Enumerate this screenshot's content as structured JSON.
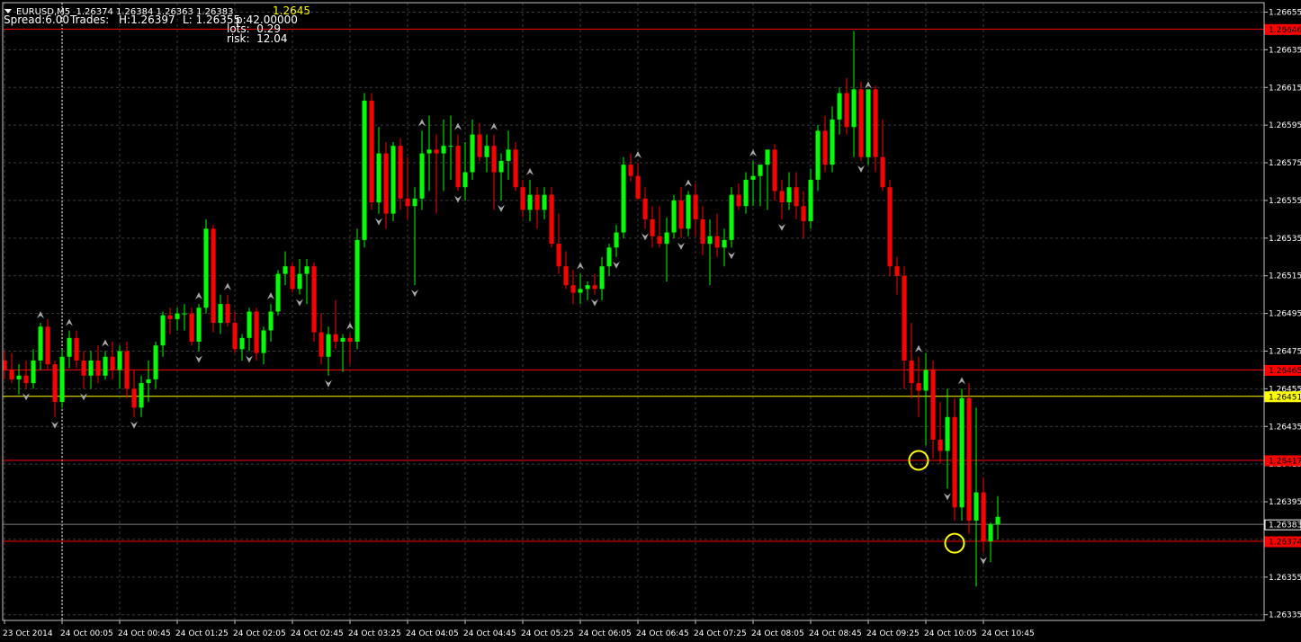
{
  "header": {
    "symbol_line": "EURUSD,M5  1.26374 1.26384 1.26363 1.26383",
    "spread": "Spread:6.00",
    "trades": "Trades:",
    "high": "H:1.26397",
    "low": "L: 1.26355",
    "pips": "p:42.00000",
    "lots": "lots:  0.29",
    "risk": "risk:  12.04",
    "level": "1.2645"
  },
  "colors": {
    "background": "#000000",
    "grid": "#3a3a3a",
    "bull": "#00ff00",
    "bear": "#ff0000",
    "frame": "#c0c0c0",
    "fractal": "#a8a8a8",
    "crosshair": "#ffffff",
    "circle": "#ffff00"
  },
  "chart_data": {
    "type": "candlestick",
    "symbol": "EURUSD",
    "timeframe": "M5",
    "ylim": [
      1.26332,
      1.2666
    ],
    "y_ticks": [
      1.26655,
      1.26635,
      1.26615,
      1.26595,
      1.26575,
      1.26555,
      1.26535,
      1.26515,
      1.26495,
      1.26475,
      1.26455,
      1.26435,
      1.26415,
      1.26395,
      1.26375,
      1.26355,
      1.26335
    ],
    "x_ticks": [
      {
        "i": 0,
        "label": "23 Oct 2014"
      },
      {
        "i": 8,
        "label": "24 Oct 00:05"
      },
      {
        "i": 16,
        "label": "24 Oct 00:45"
      },
      {
        "i": 24,
        "label": "24 Oct 01:25"
      },
      {
        "i": 32,
        "label": "24 Oct 02:05"
      },
      {
        "i": 40,
        "label": "24 Oct 02:45"
      },
      {
        "i": 48,
        "label": "24 Oct 03:25"
      },
      {
        "i": 56,
        "label": "24 Oct 04:05"
      },
      {
        "i": 64,
        "label": "24 Oct 04:45"
      },
      {
        "i": 72,
        "label": "24 Oct 05:25"
      },
      {
        "i": 80,
        "label": "24 Oct 06:05"
      },
      {
        "i": 88,
        "label": "24 Oct 06:45"
      },
      {
        "i": 96,
        "label": "24 Oct 07:25"
      },
      {
        "i": 104,
        "label": "24 Oct 08:05"
      },
      {
        "i": 112,
        "label": "24 Oct 08:45"
      },
      {
        "i": 120,
        "label": "24 Oct 09:25"
      },
      {
        "i": 128,
        "label": "24 Oct 10:05"
      },
      {
        "i": 136,
        "label": "24 Oct 10:45"
      }
    ],
    "horizontal_lines": [
      {
        "price": 1.26646,
        "label": "1.26646",
        "color": "#ff0000",
        "width": 1
      },
      {
        "price": 1.26465,
        "label": "1.26465",
        "color": "#ff0000",
        "width": 1
      },
      {
        "price": 1.26451,
        "label": "1.26451",
        "color": "#ffff00",
        "width": 1
      },
      {
        "price": 1.26417,
        "label": "1.26417",
        "color": "#ff0000",
        "width": 1
      },
      {
        "price": 1.26374,
        "label": "1.26374",
        "color": "#ff0000",
        "width": 1
      },
      {
        "price": 1.26383,
        "label": "1.26383",
        "color": "#808080",
        "width": 1
      }
    ],
    "crosshair_index": 8,
    "circles": [
      {
        "i": 127,
        "price": 1.26417
      },
      {
        "i": 132,
        "price": 1.26373
      }
    ],
    "candles": [
      [
        1.2647,
        1.26475,
        1.2646,
        1.26465
      ],
      [
        1.26465,
        1.26474,
        1.26458,
        1.2646
      ],
      [
        1.2646,
        1.26468,
        1.26452,
        1.26462
      ],
      [
        1.26462,
        1.2647,
        1.26455,
        1.26458
      ],
      [
        1.26458,
        1.26476,
        1.26455,
        1.2647
      ],
      [
        1.2647,
        1.2649,
        1.26465,
        1.26488
      ],
      [
        1.26488,
        1.26492,
        1.26465,
        1.26468
      ],
      [
        1.26468,
        1.2647,
        1.2644,
        1.26448
      ],
      [
        1.26448,
        1.26476,
        1.26445,
        1.26472
      ],
      [
        1.26472,
        1.26486,
        1.26466,
        1.26482
      ],
      [
        1.26482,
        1.26486,
        1.26466,
        1.2647
      ],
      [
        1.2647,
        1.26475,
        1.26455,
        1.26462
      ],
      [
        1.26462,
        1.26475,
        1.26455,
        1.2647
      ],
      [
        1.2647,
        1.26478,
        1.26458,
        1.26462
      ],
      [
        1.26462,
        1.26475,
        1.2646,
        1.26472
      ],
      [
        1.26472,
        1.2648,
        1.2646,
        1.26465
      ],
      [
        1.26465,
        1.26478,
        1.26455,
        1.26475
      ],
      [
        1.26475,
        1.2648,
        1.2645,
        1.26455
      ],
      [
        1.26455,
        1.26465,
        1.2644,
        1.26445
      ],
      [
        1.26445,
        1.26462,
        1.2644,
        1.26458
      ],
      [
        1.26458,
        1.2647,
        1.26448,
        1.2646
      ],
      [
        1.2646,
        1.2648,
        1.26455,
        1.26478
      ],
      [
        1.26478,
        1.26496,
        1.26472,
        1.26494
      ],
      [
        1.26494,
        1.26498,
        1.26484,
        1.26492
      ],
      [
        1.26492,
        1.26498,
        1.26486,
        1.26495
      ],
      [
        1.26495,
        1.265,
        1.26486,
        1.26495
      ],
      [
        1.26495,
        1.26498,
        1.26478,
        1.2648
      ],
      [
        1.2648,
        1.265,
        1.26475,
        1.26498
      ],
      [
        1.26498,
        1.26545,
        1.26495,
        1.2654
      ],
      [
        1.2654,
        1.26542,
        1.26485,
        1.2649
      ],
      [
        1.2649,
        1.26505,
        1.26484,
        1.265
      ],
      [
        1.265,
        1.26505,
        1.26488,
        1.2649
      ],
      [
        1.2649,
        1.26496,
        1.26474,
        1.26476
      ],
      [
        1.26476,
        1.26484,
        1.2647,
        1.26482
      ],
      [
        1.26482,
        1.26498,
        1.26475,
        1.26496
      ],
      [
        1.26496,
        1.26498,
        1.2647,
        1.26474
      ],
      [
        1.26474,
        1.26488,
        1.26468,
        1.26486
      ],
      [
        1.26486,
        1.265,
        1.2648,
        1.26496
      ],
      [
        1.26496,
        1.26518,
        1.26494,
        1.26516
      ],
      [
        1.26516,
        1.26528,
        1.2651,
        1.2652
      ],
      [
        1.2652,
        1.26522,
        1.26506,
        1.26508
      ],
      [
        1.26508,
        1.26524,
        1.26505,
        1.26516
      ],
      [
        1.26516,
        1.26524,
        1.265,
        1.2652
      ],
      [
        1.2652,
        1.26522,
        1.2648,
        1.26485
      ],
      [
        1.26485,
        1.26495,
        1.26468,
        1.26472
      ],
      [
        1.26472,
        1.26488,
        1.26462,
        1.26484
      ],
      [
        1.26484,
        1.26502,
        1.26476,
        1.2648
      ],
      [
        1.2648,
        1.26484,
        1.26464,
        1.26482
      ],
      [
        1.26482,
        1.26484,
        1.26468,
        1.2648
      ],
      [
        1.2648,
        1.2654,
        1.26476,
        1.26534
      ],
      [
        1.26534,
        1.26612,
        1.2653,
        1.26608
      ],
      [
        1.26608,
        1.26612,
        1.2655,
        1.26554
      ],
      [
        1.26554,
        1.26594,
        1.26548,
        1.2658
      ],
      [
        1.2658,
        1.26586,
        1.2654,
        1.26548
      ],
      [
        1.26548,
        1.26586,
        1.26544,
        1.26584
      ],
      [
        1.26584,
        1.26588,
        1.2655,
        1.26556
      ],
      [
        1.26556,
        1.26578,
        1.26545,
        1.26552
      ],
      [
        1.26552,
        1.26562,
        1.2651,
        1.26556
      ],
      [
        1.26556,
        1.26592,
        1.2655,
        1.2658
      ],
      [
        1.2658,
        1.266,
        1.2656,
        1.26582
      ],
      [
        1.26582,
        1.2659,
        1.26548,
        1.2658
      ],
      [
        1.2658,
        1.26598,
        1.2656,
        1.26584
      ],
      [
        1.26584,
        1.266,
        1.26566,
        1.26584
      ],
      [
        1.26584,
        1.2659,
        1.2656,
        1.26562
      ],
      [
        1.26562,
        1.26586,
        1.26555,
        1.2657
      ],
      [
        1.2657,
        1.26598,
        1.26566,
        1.2659
      ],
      [
        1.2659,
        1.26596,
        1.26576,
        1.26578
      ],
      [
        1.26578,
        1.2659,
        1.2657,
        1.26584
      ],
      [
        1.26584,
        1.2659,
        1.2655,
        1.2657
      ],
      [
        1.2657,
        1.2658,
        1.26555,
        1.26576
      ],
      [
        1.26576,
        1.26592,
        1.26566,
        1.26582
      ],
      [
        1.26582,
        1.26586,
        1.2656,
        1.26562
      ],
      [
        1.26562,
        1.26566,
        1.26546,
        1.2655
      ],
      [
        1.2655,
        1.26566,
        1.26544,
        1.26558
      ],
      [
        1.26558,
        1.26562,
        1.2654,
        1.2655
      ],
      [
        1.2655,
        1.26562,
        1.26545,
        1.26558
      ],
      [
        1.26558,
        1.26562,
        1.2653,
        1.26532
      ],
      [
        1.26532,
        1.26548,
        1.26516,
        1.2652
      ],
      [
        1.2652,
        1.26528,
        1.26508,
        1.2651
      ],
      [
        1.2651,
        1.26518,
        1.265,
        1.26506
      ],
      [
        1.26506,
        1.26516,
        1.265,
        1.26508
      ],
      [
        1.26508,
        1.26512,
        1.26502,
        1.2651
      ],
      [
        1.2651,
        1.26516,
        1.26505,
        1.26508
      ],
      [
        1.26508,
        1.26525,
        1.26502,
        1.2652
      ],
      [
        1.2652,
        1.26532,
        1.26515,
        1.2653
      ],
      [
        1.2653,
        1.26542,
        1.26525,
        1.26538
      ],
      [
        1.26538,
        1.26578,
        1.26535,
        1.26574
      ],
      [
        1.26574,
        1.2658,
        1.26565,
        1.26568
      ],
      [
        1.26568,
        1.26575,
        1.26555,
        1.26556
      ],
      [
        1.26556,
        1.26562,
        1.2654,
        1.26545
      ],
      [
        1.26545,
        1.26552,
        1.2653,
        1.26536
      ],
      [
        1.26536,
        1.26552,
        1.2653,
        1.26532
      ],
      [
        1.26532,
        1.26546,
        1.26512,
        1.26538
      ],
      [
        1.26538,
        1.26558,
        1.26535,
        1.26555
      ],
      [
        1.26555,
        1.26562,
        1.26535,
        1.2654
      ],
      [
        1.2654,
        1.2656,
        1.26536,
        1.26558
      ],
      [
        1.26558,
        1.26564,
        1.26536,
        1.26545
      ],
      [
        1.26545,
        1.26552,
        1.26526,
        1.26532
      ],
      [
        1.26532,
        1.26545,
        1.2651,
        1.26536
      ],
      [
        1.26536,
        1.26548,
        1.26525,
        1.2653
      ],
      [
        1.2653,
        1.2654,
        1.2652,
        1.26534
      ],
      [
        1.26534,
        1.26562,
        1.2653,
        1.26558
      ],
      [
        1.26558,
        1.26564,
        1.2655,
        1.26552
      ],
      [
        1.26552,
        1.2657,
        1.26548,
        1.26566
      ],
      [
        1.26566,
        1.26576,
        1.26552,
        1.26568
      ],
      [
        1.26568,
        1.26572,
        1.26552,
        1.26574
      ],
      [
        1.26574,
        1.2658,
        1.2655,
        1.26582
      ],
      [
        1.26582,
        1.26585,
        1.26555,
        1.2656
      ],
      [
        1.2656,
        1.26566,
        1.26545,
        1.26554
      ],
      [
        1.26554,
        1.2657,
        1.2655,
        1.26562
      ],
      [
        1.26562,
        1.2657,
        1.26545,
        1.26552
      ],
      [
        1.26552,
        1.2656,
        1.26535,
        1.26544
      ],
      [
        1.26544,
        1.26572,
        1.2654,
        1.26566
      ],
      [
        1.26566,
        1.26595,
        1.2656,
        1.26592
      ],
      [
        1.26592,
        1.266,
        1.2657,
        1.26574
      ],
      [
        1.26574,
        1.26605,
        1.2657,
        1.26598
      ],
      [
        1.26598,
        1.26615,
        1.2659,
        1.26612
      ],
      [
        1.26612,
        1.2662,
        1.2659,
        1.26594
      ],
      [
        1.26594,
        1.26645,
        1.26578,
        1.26614
      ],
      [
        1.26614,
        1.26618,
        1.26576,
        1.26578
      ],
      [
        1.26578,
        1.26612,
        1.26574,
        1.26614
      ],
      [
        1.26614,
        1.26616,
        1.2657,
        1.26578
      ],
      [
        1.26578,
        1.26598,
        1.2656,
        1.26562
      ],
      [
        1.26562,
        1.26566,
        1.26515,
        1.2652
      ],
      [
        1.2652,
        1.26525,
        1.26505,
        1.26515
      ],
      [
        1.26515,
        1.2652,
        1.26455,
        1.2647
      ],
      [
        1.2647,
        1.2649,
        1.2645,
        1.26458
      ],
      [
        1.26458,
        1.26472,
        1.2644,
        1.26454
      ],
      [
        1.26454,
        1.26474,
        1.26425,
        1.26465
      ],
      [
        1.26465,
        1.2647,
        1.26418,
        1.26428
      ],
      [
        1.26428,
        1.26448,
        1.26415,
        1.26422
      ],
      [
        1.26422,
        1.26455,
        1.26402,
        1.2644
      ],
      [
        1.2644,
        1.2645,
        1.26385,
        1.26392
      ],
      [
        1.26392,
        1.26455,
        1.26385,
        1.2645
      ],
      [
        1.2645,
        1.26458,
        1.26378,
        1.26385
      ],
      [
        1.26385,
        1.26445,
        1.2635,
        1.264
      ],
      [
        1.264,
        1.26408,
        1.26368,
        1.26374
      ],
      [
        1.26374,
        1.26384,
        1.26363,
        1.26383
      ],
      [
        1.26383,
        1.26398,
        1.26375,
        1.26387
      ]
    ],
    "fractals_up": [
      5,
      9,
      14,
      27,
      31,
      37,
      48,
      58,
      63,
      68,
      73,
      80,
      88,
      95,
      104,
      120,
      127,
      133
    ],
    "fractals_down": [
      3,
      7,
      11,
      18,
      27,
      34,
      41,
      45,
      52,
      57,
      63,
      69,
      82,
      85,
      89,
      94,
      101,
      108,
      119,
      131,
      136
    ]
  }
}
